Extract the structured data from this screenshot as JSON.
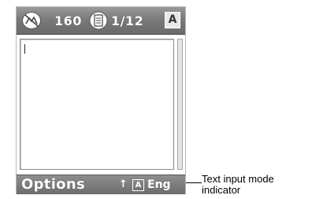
{
  "status": {
    "signal_icon": "no-network-icon",
    "char_count": "160",
    "message_icon": "message-page-icon",
    "page": "1/12",
    "input_mode": "A"
  },
  "softkeys": {
    "left_label": "Options",
    "arrow_icon": "up-arrow-icon",
    "mode_box": "A",
    "mode_language": "Eng"
  },
  "annotation": {
    "line1": "Text input mode",
    "line2": "indicator"
  },
  "colors": {
    "status_bar": "#7a7a7a",
    "soft_bar": "#6c6c6c",
    "text_area": "#ffffff"
  }
}
